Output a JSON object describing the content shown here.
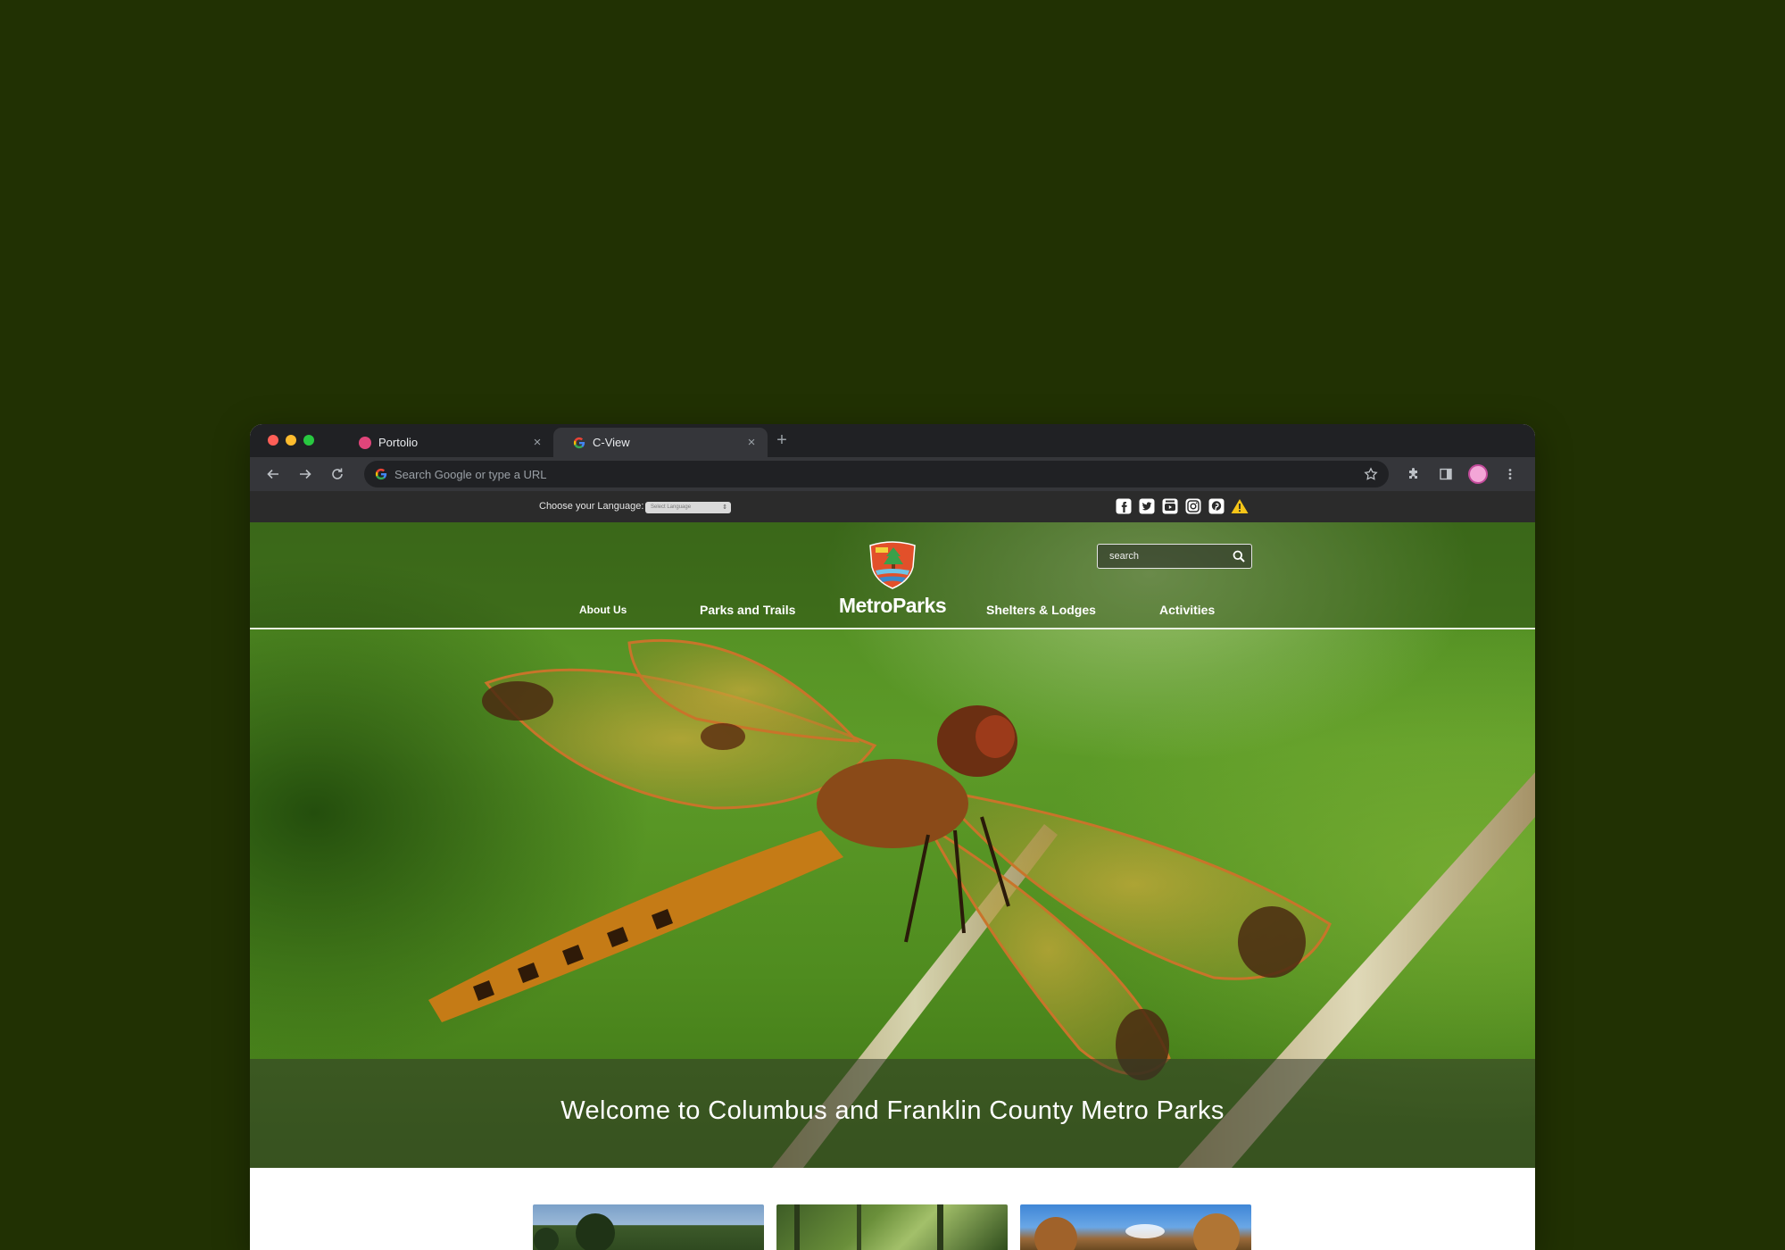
{
  "browser": {
    "tabs": [
      {
        "title": "Portolio",
        "favicon": "pink-circle-icon",
        "active": false
      },
      {
        "title": "C-View",
        "favicon": "google-icon",
        "active": true
      }
    ],
    "omnibox_placeholder": "Search Google or type a URL",
    "tab_close_glyph": "×",
    "new_tab_glyph": "+"
  },
  "site": {
    "language_label": "Choose your Language:",
    "language_select": "Select Language",
    "social_icons": [
      "facebook-icon",
      "twitter-icon",
      "youtube-icon",
      "instagram-icon",
      "pinterest-icon",
      "alert-icon"
    ],
    "logo_text": "MetroParks",
    "nav": {
      "about": "About Us",
      "parks": "Parks and Trails",
      "shelters": "Shelters & Lodges",
      "activities": "Activities"
    },
    "search_placeholder": "search",
    "hero_title": "Welcome to Columbus and Franklin County Metro Parks",
    "thumbnails": [
      "park-photo-trees",
      "park-photo-forest",
      "park-photo-autumn"
    ]
  },
  "colors": {
    "background": "#213103",
    "chrome_tabbar": "#202124",
    "chrome_toolbar": "#35363a",
    "utility_bar": "#2b2b2b",
    "alert": "#f5c518"
  }
}
